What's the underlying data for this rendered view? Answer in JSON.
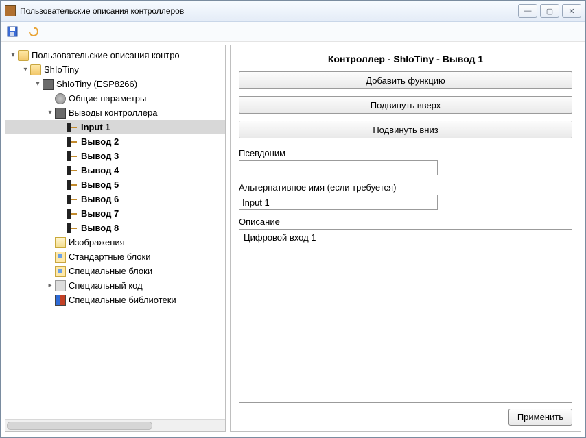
{
  "window": {
    "title": "Пользовательские описания контроллеров"
  },
  "tree": {
    "root": "Пользовательские описания контро",
    "shiotiny": "ShIoTiny",
    "shiotiny_esp": "ShIoTiny (ESP8266)",
    "general_params": "Общие параметры",
    "outputs": "Выводы контроллера",
    "pins": [
      "Input 1",
      "Вывод 2",
      "Вывод 3",
      "Вывод 4",
      "Вывод 5",
      "Вывод 6",
      "Вывод 7",
      "Вывод 8"
    ],
    "images": "Изображения",
    "std_blocks": "Стандартные блоки",
    "spec_blocks": "Специальные блоки",
    "spec_code": "Специальный код",
    "spec_libs": "Специальные библиотеки"
  },
  "form": {
    "title": "Контроллер - ShIoTiny - Вывод 1",
    "add_function": "Добавить функцию",
    "move_up": "Подвинуть вверх",
    "move_down": "Подвинуть вниз",
    "alias_label": "Псевдоним",
    "alias_value": "",
    "altname_label": "Альтернативное имя (если требуется)",
    "altname_value": "Input 1",
    "desc_label": "Описание",
    "desc_value": "Цифровой вход 1",
    "apply": "Применить"
  }
}
